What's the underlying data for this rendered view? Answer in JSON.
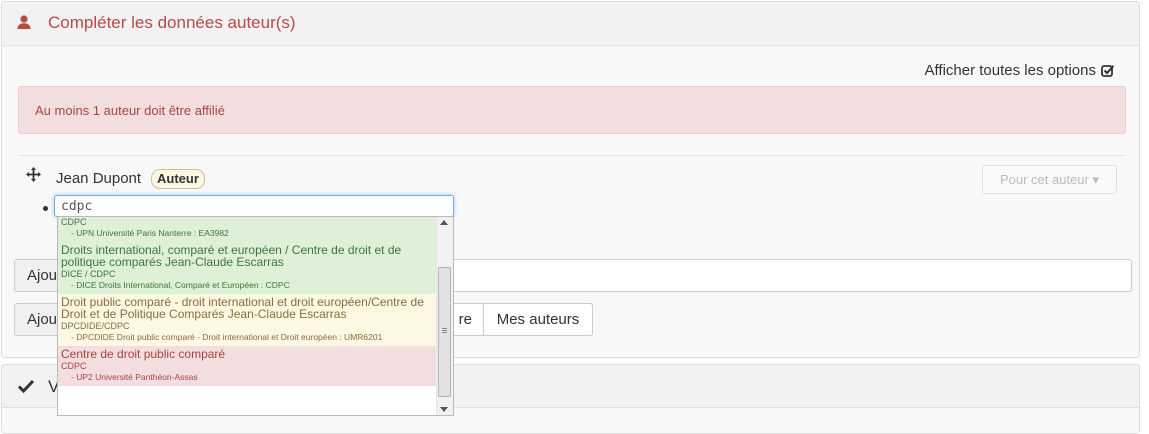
{
  "panel": {
    "title": "Compléter les données auteur(s)",
    "accent_color": "#b94a48",
    "icon": "user-icon"
  },
  "options_toggle": {
    "label": "Afficher toutes les options",
    "icon": "check-square-icon"
  },
  "alert": {
    "message": "Au moins 1 auteur doit être affilié"
  },
  "author": {
    "name": "Jean Dupont",
    "role": "Auteur",
    "dropdown_label": "Pour cet auteur ▾"
  },
  "affiliation_search": {
    "value": "cdpc"
  },
  "background_buttons": {
    "add_1": "Ajou",
    "add_2": "Ajou",
    "partial": "re",
    "mine": "Mes auteurs"
  },
  "suggestions": [
    {
      "color": "green",
      "title": "",
      "acronym": "CDPC",
      "detail": "- UPN Université Paris Nanterre : EA3982"
    },
    {
      "color": "green",
      "title": "Droits international, comparé et européen / Centre de droit et de politique comparés Jean-Claude Escarras",
      "acronym": "DICE / CDPC",
      "detail": "- DICE Droits International, Comparé et Européen : CDPC"
    },
    {
      "color": "yellow",
      "title": "Droit public comparé - droit international et droit européen/Centre de Droit et de Politique Comparés Jean-Claude Escarras",
      "acronym": "DPCDIDE/CDPC",
      "detail": "- DPCDIDE Droit public comparé - Droit international et Droit européen : UMR6201"
    },
    {
      "color": "red",
      "title": "Centre de droit public comparé",
      "acronym": "CDPC",
      "detail": "- UP2 Université Panthéon-Assas"
    }
  ],
  "panel2": {
    "title": "V",
    "icon": "checkmark-icon"
  }
}
